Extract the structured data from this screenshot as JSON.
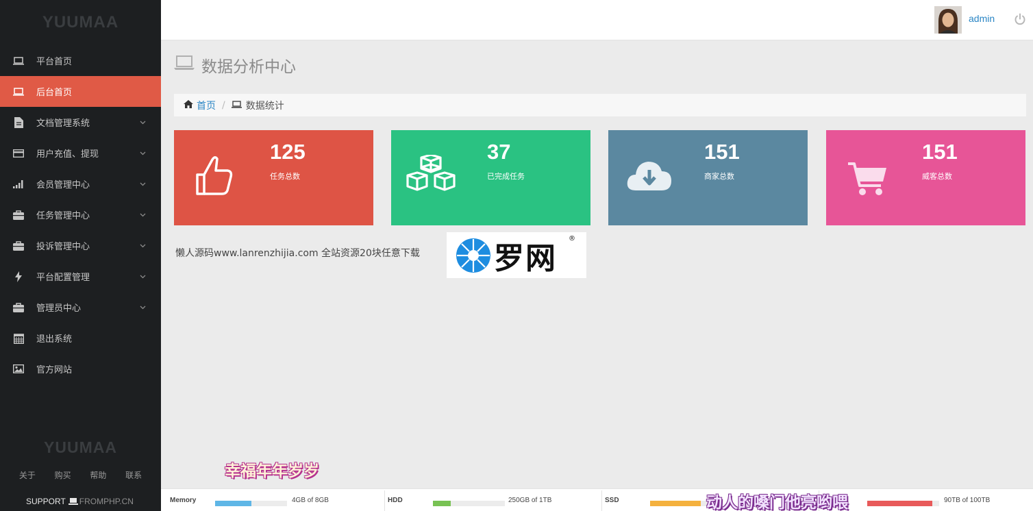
{
  "sidebar": {
    "logo": "YUUMAA",
    "items": [
      {
        "label": "平台首页",
        "icon": "laptop-icon",
        "expandable": false,
        "active": false
      },
      {
        "label": "后台首页",
        "icon": "laptop-icon",
        "expandable": false,
        "active": true
      },
      {
        "label": "文档管理系统",
        "icon": "file-icon",
        "expandable": true,
        "active": false
      },
      {
        "label": "用户充值、提现",
        "icon": "card-icon",
        "expandable": true,
        "active": false
      },
      {
        "label": "会员管理中心",
        "icon": "signal-icon",
        "expandable": true,
        "active": false
      },
      {
        "label": "任务管理中心",
        "icon": "briefcase-icon",
        "expandable": true,
        "active": false
      },
      {
        "label": "投诉管理中心",
        "icon": "briefcase-icon",
        "expandable": true,
        "active": false
      },
      {
        "label": "平台配置管理",
        "icon": "bolt-icon",
        "expandable": true,
        "active": false
      },
      {
        "label": "管理员中心",
        "icon": "briefcase-icon",
        "expandable": true,
        "active": false
      },
      {
        "label": "退出系统",
        "icon": "calendar-icon",
        "expandable": false,
        "active": false
      },
      {
        "label": "官方网站",
        "icon": "image-icon",
        "expandable": false,
        "active": false
      }
    ],
    "footer_logo": "YUUMAA",
    "footer_links": [
      "关于",
      "购买",
      "帮助",
      "联系"
    ],
    "support_label": "SUPPORT",
    "support_domain": "FROMPHP.CN"
  },
  "topbar": {
    "username": "admin"
  },
  "main": {
    "page_title": "数据分析中心",
    "breadcrumb": {
      "home": "首页",
      "current": "数据统计"
    },
    "cards": [
      {
        "value": "125",
        "label": "任务总数",
        "color": "#de5445",
        "icon": "thumbs-up-icon"
      },
      {
        "value": "37",
        "label": "已完成任务",
        "color": "#2ac282",
        "icon": "cubes-icon"
      },
      {
        "value": "151",
        "label": "商家总数",
        "color": "#5b88a0",
        "icon": "cloud-download-icon"
      },
      {
        "value": "151",
        "label": "威客总数",
        "color": "#e75597",
        "icon": "cart-icon"
      }
    ],
    "promo_text": "懒人源码www.lanrenzhijia.com 全站资源20块任意下载",
    "watermark_logo_text": "罗网",
    "watermark_reg": "®"
  },
  "overlays": {
    "subtitle_1": "幸福年年岁岁",
    "subtitle_2": "动人的嗓门他亮哟喂"
  },
  "statusbar": {
    "items": [
      {
        "name": "Memory",
        "value": "4GB of 8GB",
        "fraction": 0.5,
        "color": "#5fb6e6"
      },
      {
        "name": "HDD",
        "value": "250GB of 1TB",
        "fraction": 0.25,
        "color": "#78c254"
      },
      {
        "name": "SSD",
        "value": "",
        "fraction": 0.7,
        "color": "#f4b13e"
      },
      {
        "name": "",
        "value": "90TB of 100TB",
        "fraction": 0.9,
        "color": "#e85a5a"
      }
    ]
  }
}
